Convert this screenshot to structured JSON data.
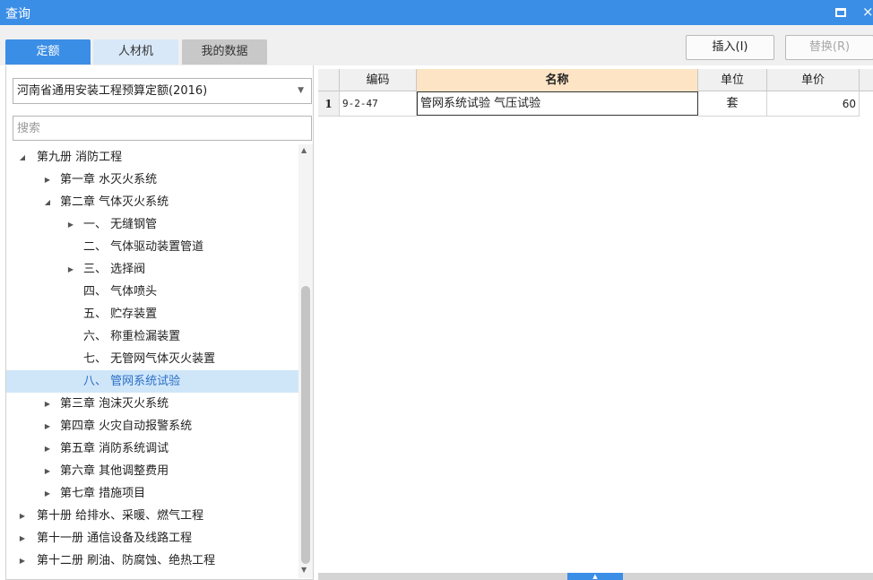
{
  "window": {
    "title": "查询",
    "restore_icon": "restore-icon",
    "close_icon": "close-icon",
    "close_glyph": "×"
  },
  "tabs": [
    {
      "label": "定额",
      "active": true
    },
    {
      "label": "人材机",
      "active": false
    },
    {
      "label": "我的数据",
      "active": false
    }
  ],
  "actions": {
    "insert_label": "插入(I)",
    "replace_label": "替换(R)"
  },
  "left_panel": {
    "quota_library": "河南省通用安装工程预算定额(2016)",
    "search_placeholder": "搜索"
  },
  "tree": [
    {
      "label": "第九册 消防工程",
      "level": 0,
      "toggle": "expanded"
    },
    {
      "label": "第一章 水灭火系统",
      "level": 1,
      "toggle": "collapsed"
    },
    {
      "label": "第二章 气体灭火系统",
      "level": 1,
      "toggle": "expanded"
    },
    {
      "label": "一、 无缝钢管",
      "level": 2,
      "toggle": "collapsed"
    },
    {
      "label": "二、 气体驱动装置管道",
      "level": 2,
      "toggle": "none"
    },
    {
      "label": "三、 选择阀",
      "level": 2,
      "toggle": "collapsed"
    },
    {
      "label": "四、 气体喷头",
      "level": 2,
      "toggle": "none"
    },
    {
      "label": "五、 贮存装置",
      "level": 2,
      "toggle": "none"
    },
    {
      "label": "六、 称重检漏装置",
      "level": 2,
      "toggle": "none"
    },
    {
      "label": "七、 无管网气体灭火装置",
      "level": 2,
      "toggle": "none"
    },
    {
      "label": "八、 管网系统试验",
      "level": 2,
      "toggle": "none",
      "selected": true
    },
    {
      "label": "第三章 泡沫灭火系统",
      "level": 1,
      "toggle": "collapsed"
    },
    {
      "label": "第四章 火灾自动报警系统",
      "level": 1,
      "toggle": "collapsed"
    },
    {
      "label": "第五章 消防系统调试",
      "level": 1,
      "toggle": "collapsed"
    },
    {
      "label": "第六章 其他调整费用",
      "level": 1,
      "toggle": "collapsed"
    },
    {
      "label": "第七章 措施项目",
      "level": 1,
      "toggle": "collapsed"
    },
    {
      "label": "第十册 给排水、采暖、燃气工程",
      "level": 0,
      "toggle": "collapsed"
    },
    {
      "label": "第十一册 通信设备及线路工程",
      "level": 0,
      "toggle": "collapsed"
    },
    {
      "label": "第十二册 刷油、防腐蚀、绝热工程",
      "level": 0,
      "toggle": "collapsed"
    }
  ],
  "table": {
    "headers": {
      "code": "编码",
      "name": "名称",
      "unit": "单位",
      "price": "单价"
    },
    "rows": [
      {
        "no": "1",
        "code": "9-2-47",
        "name": "管网系统试验 气压试验",
        "unit": "套",
        "price": "60"
      }
    ]
  }
}
